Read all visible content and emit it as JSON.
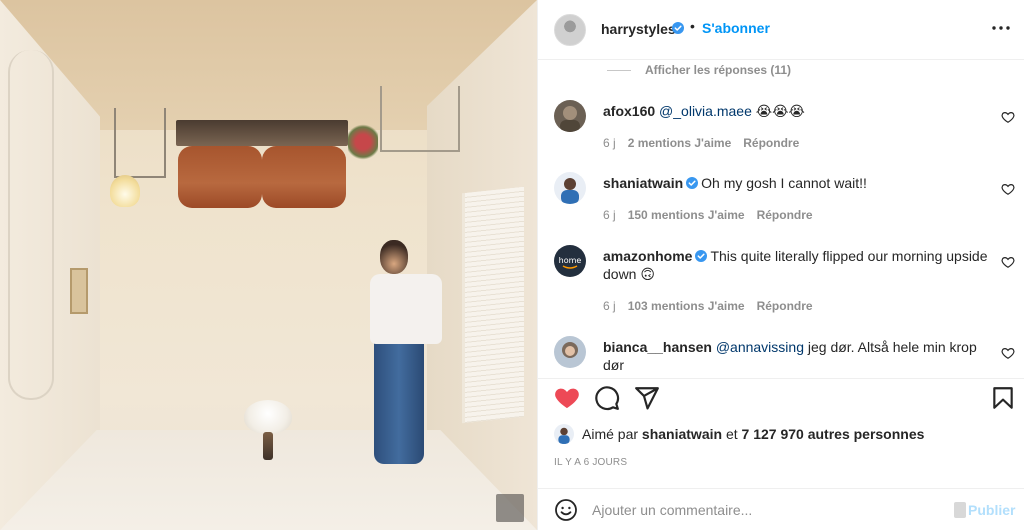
{
  "post": {
    "author": "harrystyles",
    "dot": "•",
    "follow_label": "S'abonner",
    "more_label": "•••"
  },
  "comments": {
    "view_replies": "Afficher les réponses (11)",
    "items": [
      {
        "username": "afox160",
        "verified": false,
        "mention": "@_olivia.maee",
        "text": " 😭😭😭",
        "time": "6 j",
        "likes": "2 mentions J'aime",
        "reply": "Répondre"
      },
      {
        "username": "shaniatwain",
        "verified": true,
        "mention": "",
        "text": "Oh my gosh I cannot wait!!",
        "time": "6 j",
        "likes": "150 mentions J'aime",
        "reply": "Répondre"
      },
      {
        "username": "amazonhome",
        "verified": true,
        "mention": "",
        "text": "This quite literally flipped our morning upside down 🙃",
        "time": "6 j",
        "likes": "103 mentions J'aime",
        "reply": "Répondre"
      },
      {
        "username": "bianca__hansen",
        "verified": false,
        "mention": "@annavissing",
        "text": " jeg dør. Altså hele min krop dør",
        "time": "",
        "likes": "",
        "reply": ""
      }
    ]
  },
  "likes": {
    "prefix": "Aimé par ",
    "liked_by": "shaniatwain",
    "middle": " et ",
    "count": "7 127 970 autres personnes"
  },
  "timestamp": "IL Y A 6 JOURS",
  "composer": {
    "placeholder": "Ajouter un commentaire...",
    "publish_label": "Publier"
  },
  "colors": {
    "accent": "#0095f6",
    "liked_heart": "#ed4956",
    "verified": "#3897f0",
    "publish_disabled": "#b2dffc"
  },
  "icons": {
    "verified": "verified-badge-icon",
    "more": "more-options-icon",
    "heart": "heart-icon",
    "comment": "comment-icon",
    "share": "share-icon",
    "save": "bookmark-icon",
    "emoji": "emoji-icon"
  }
}
